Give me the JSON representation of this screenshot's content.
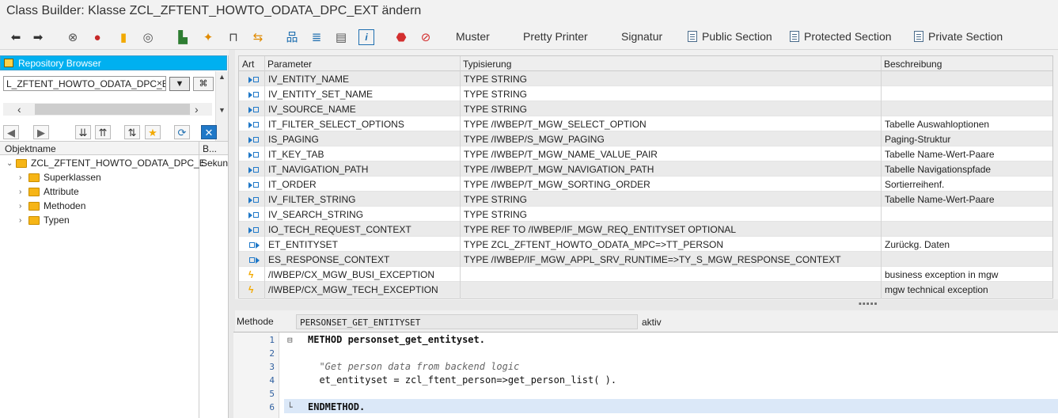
{
  "window": {
    "title": "Class Builder: Klasse ZCL_ZFTENT_HOWTO_ODATA_DPC_EXT ändern"
  },
  "toolbar": {
    "icons": [
      "back-icon",
      "forward-icon",
      "glasses-icon",
      "object-icon",
      "activate-icon",
      "where-used-icon",
      "check-icon",
      "magic-wand-icon",
      "move-icon",
      "align-icon",
      "hierarchy-icon",
      "stack-icon",
      "layout-icon",
      "info-icon",
      "stop-icon",
      "break-icon"
    ],
    "buttons": {
      "muster": "Muster",
      "pretty_printer": "Pretty Printer",
      "signatur": "Signatur",
      "public_section": "Public Section",
      "protected_section": "Protected Section",
      "private_section": "Private Section"
    }
  },
  "repository": {
    "header": "Repository Browser",
    "object_value": "L_ZFTENT_HOWTO_ODATA_DPC_E",
    "clear_symbol": "×",
    "tree_columns": {
      "name": "Objektname",
      "b": "B..."
    },
    "root": {
      "label": "ZCL_ZFTENT_HOWTO_ODATA_DPC_E",
      "b": "Sekun"
    },
    "children": [
      "Superklassen",
      "Attribute",
      "Methoden",
      "Typen"
    ]
  },
  "params": {
    "headers": {
      "art": "Art",
      "parameter": "Parameter",
      "typisierung": "Typisierung",
      "beschreibung": "Beschreibung"
    },
    "rows": [
      {
        "kind": "importing",
        "name": "IV_ENTITY_NAME",
        "type": "TYPE STRING",
        "desc": ""
      },
      {
        "kind": "importing",
        "name": "IV_ENTITY_SET_NAME",
        "type": "TYPE STRING",
        "desc": ""
      },
      {
        "kind": "importing",
        "name": "IV_SOURCE_NAME",
        "type": "TYPE STRING",
        "desc": ""
      },
      {
        "kind": "importing",
        "name": "IT_FILTER_SELECT_OPTIONS",
        "type": "TYPE /IWBEP/T_MGW_SELECT_OPTION",
        "desc": "Tabelle Auswahloptionen"
      },
      {
        "kind": "importing",
        "name": "IS_PAGING",
        "type": "TYPE /IWBEP/S_MGW_PAGING",
        "desc": "Paging-Struktur"
      },
      {
        "kind": "importing",
        "name": "IT_KEY_TAB",
        "type": "TYPE /IWBEP/T_MGW_NAME_VALUE_PAIR",
        "desc": "Tabelle Name-Wert-Paare"
      },
      {
        "kind": "importing",
        "name": "IT_NAVIGATION_PATH",
        "type": "TYPE /IWBEP/T_MGW_NAVIGATION_PATH",
        "desc": "Tabelle Navigationspfade"
      },
      {
        "kind": "importing",
        "name": "IT_ORDER",
        "type": "TYPE /IWBEP/T_MGW_SORTING_ORDER",
        "desc": "Sortierreihenf."
      },
      {
        "kind": "importing",
        "name": "IV_FILTER_STRING",
        "type": "TYPE STRING",
        "desc": "Tabelle Name-Wert-Paare"
      },
      {
        "kind": "importing",
        "name": "IV_SEARCH_STRING",
        "type": "TYPE STRING",
        "desc": ""
      },
      {
        "kind": "importing",
        "name": "IO_TECH_REQUEST_CONTEXT",
        "type": "TYPE REF TO /IWBEP/IF_MGW_REQ_ENTITYSET OPTIONAL",
        "desc": ""
      },
      {
        "kind": "exporting",
        "name": "ET_ENTITYSET",
        "type": "TYPE ZCL_ZFTENT_HOWTO_ODATA_MPC=>TT_PERSON",
        "desc": "Zurückg. Daten"
      },
      {
        "kind": "exporting",
        "name": "ES_RESPONSE_CONTEXT",
        "type": "TYPE /IWBEP/IF_MGW_APPL_SRV_RUNTIME=>TY_S_MGW_RESPONSE_CONTEXT",
        "desc": ""
      },
      {
        "kind": "exception",
        "name": "/IWBEP/CX_MGW_BUSI_EXCEPTION",
        "type": "",
        "desc": "business exception in mgw"
      },
      {
        "kind": "exception",
        "name": "/IWBEP/CX_MGW_TECH_EXCEPTION",
        "type": "",
        "desc": "mgw technical exception"
      }
    ]
  },
  "method": {
    "label": "Methode",
    "name": "PERSONSET_GET_ENTITYSET",
    "status": "aktiv"
  },
  "editor": {
    "lines": [
      {
        "no": "1",
        "fold": "⊟",
        "text": "METHOD personset_get_entityset.",
        "kw": true
      },
      {
        "no": "2",
        "fold": "",
        "text": "",
        "kw": false
      },
      {
        "no": "3",
        "fold": "",
        "text": "  \"Get person data from backend logic",
        "kw": false,
        "comment": true
      },
      {
        "no": "4",
        "fold": "",
        "text": "  et_entityset = zcl_ftent_person=>get_person_list( ).",
        "kw": false
      },
      {
        "no": "5",
        "fold": "",
        "text": "",
        "kw": false
      },
      {
        "no": "6",
        "fold": "└",
        "text": "ENDMETHOD.",
        "kw": true
      }
    ]
  },
  "colors": {
    "accent": "#00b0f0",
    "folder": "#f6b516",
    "current_line": "#dbe8f8"
  }
}
